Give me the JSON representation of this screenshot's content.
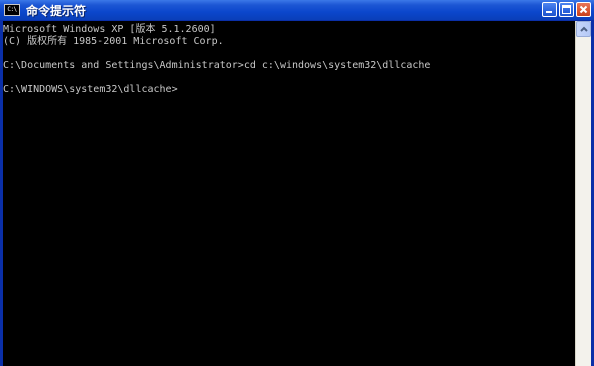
{
  "window": {
    "title": "命令提示符",
    "icon": "cmd-icon",
    "icon_text": "C:\\",
    "controls": [
      "minimize-icon",
      "maximize-icon",
      "close-icon"
    ]
  },
  "console": {
    "lines": [
      "Microsoft Windows XP [版本 5.1.2600]",
      "(C) 版权所有 1985-2001 Microsoft Corp.",
      "",
      "C:\\Documents and Settings\\Administrator>cd c:\\windows\\system32\\dllcache",
      "",
      "C:\\WINDOWS\\system32\\dllcache>"
    ]
  },
  "colors": {
    "titlebar": "#0b47cc",
    "console_bg": "#000000",
    "console_text": "#c8c8c8",
    "close_button": "#d9542e"
  }
}
